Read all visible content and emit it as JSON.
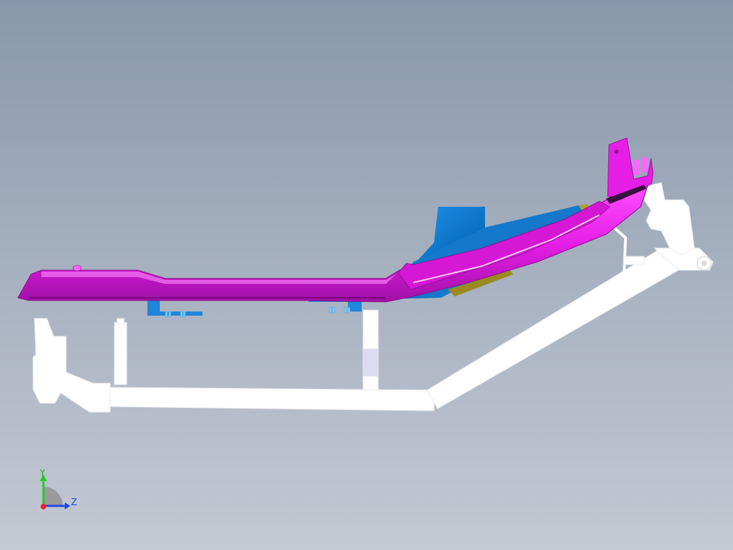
{
  "viewport": {
    "background_top": "#8897ab",
    "background_bottom": "#c4c9d3"
  },
  "parts": {
    "magenta_color": "#e61ee6",
    "blue_color": "#0a7fd6",
    "fixture_color": "#ffffff"
  },
  "axis_triad": {
    "y_label": "Y",
    "z_label": "Z",
    "y_color": "#22cc22",
    "z_color": "#2244ee",
    "x_color": "#ee2222"
  }
}
